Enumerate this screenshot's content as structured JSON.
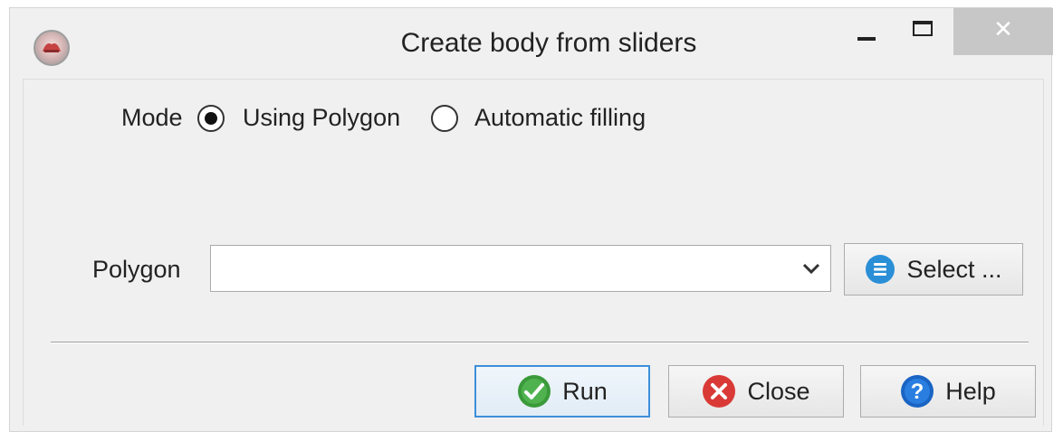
{
  "window": {
    "title": "Create body from sliders",
    "app_icon": "app-logo-icon",
    "controls": [
      "minimize-icon",
      "maximize-icon",
      "close-icon"
    ],
    "close_glyph": "✕"
  },
  "mode": {
    "label": "Mode",
    "options": [
      {
        "label": "Using Polygon",
        "checked": true
      },
      {
        "label": "Automatic filling",
        "checked": false
      }
    ]
  },
  "polygon": {
    "label": "Polygon",
    "value": "",
    "select_button": "Select ...",
    "select_icon": "list-icon"
  },
  "footer": {
    "run_label": "Run",
    "close_label": "Close",
    "help_label": "Help",
    "help_glyph": "?"
  },
  "colors": {
    "run_icon": "#3a9a3a",
    "close_icon": "#d93a36",
    "help_icon": "#1a64c4",
    "list_icon": "#2a8fd6",
    "default_button_border": "#3c8fdb"
  }
}
